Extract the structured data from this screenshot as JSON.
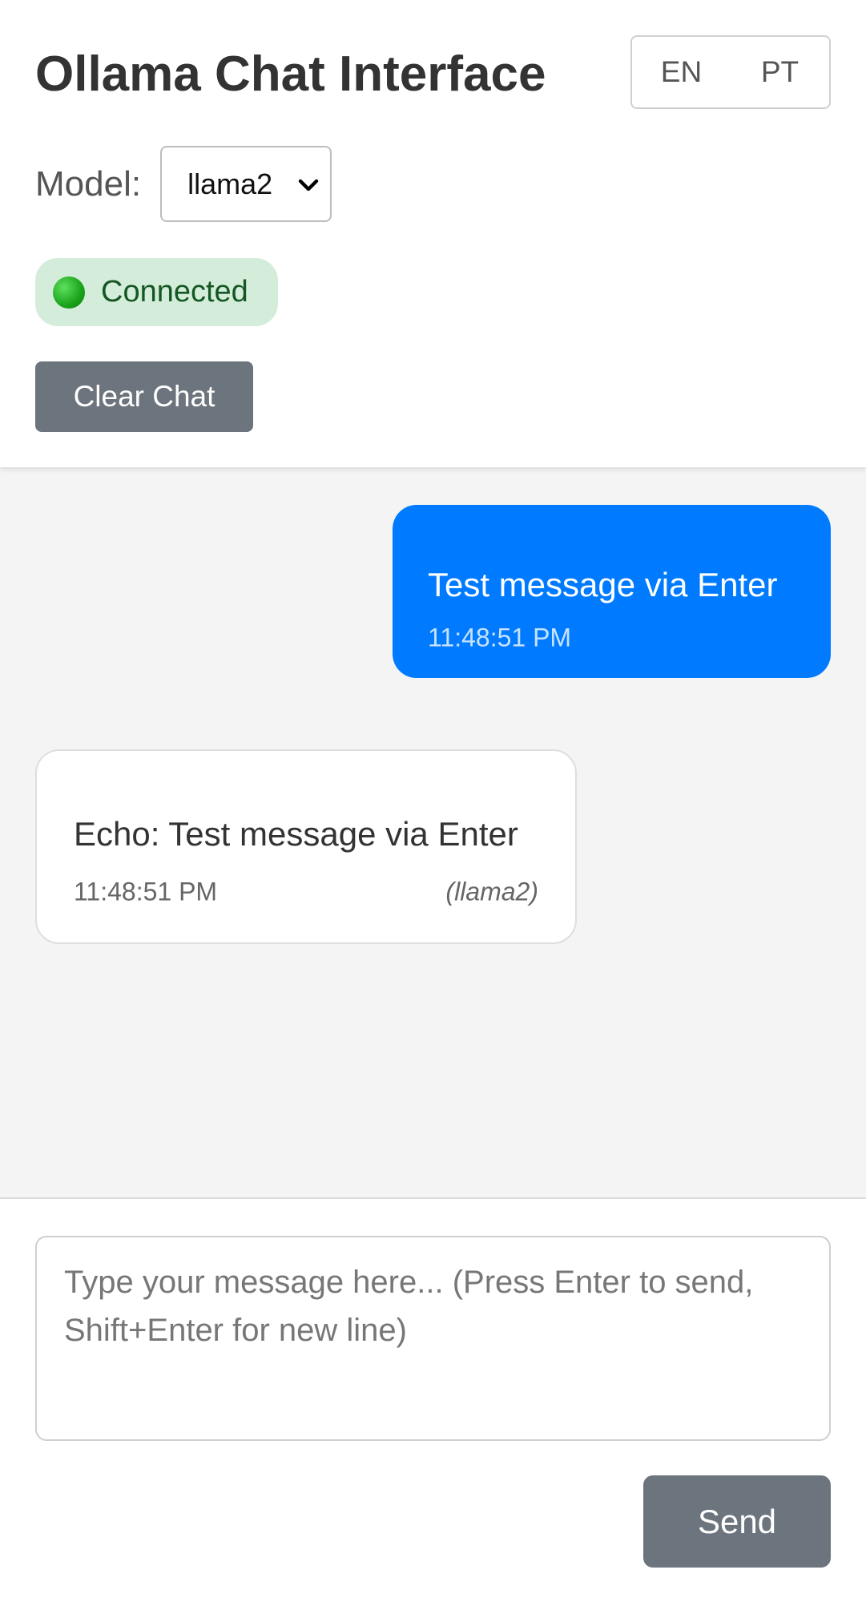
{
  "header": {
    "title": "Ollama Chat Interface",
    "languages": [
      "EN",
      "PT"
    ],
    "model_label": "Model:",
    "selected_model": "llama2",
    "status_text": "Connected",
    "clear_label": "Clear Chat"
  },
  "messages": [
    {
      "role": "user",
      "text": "Test message via Enter",
      "time": "11:48:51 PM"
    },
    {
      "role": "assistant",
      "text": "Echo: Test message via Enter",
      "time": "11:48:51 PM",
      "model": "(llama2)"
    }
  ],
  "composer": {
    "placeholder": "Type your message here... (Press Enter to send, Shift+Enter for new line)",
    "send_label": "Send"
  },
  "colors": {
    "user_bubble": "#007bff",
    "status_bg": "#d4edda",
    "status_text": "#155724",
    "button": "#6c757d"
  },
  "icons": {
    "status": "green-dot-icon",
    "select": "chevron-down-icon"
  }
}
